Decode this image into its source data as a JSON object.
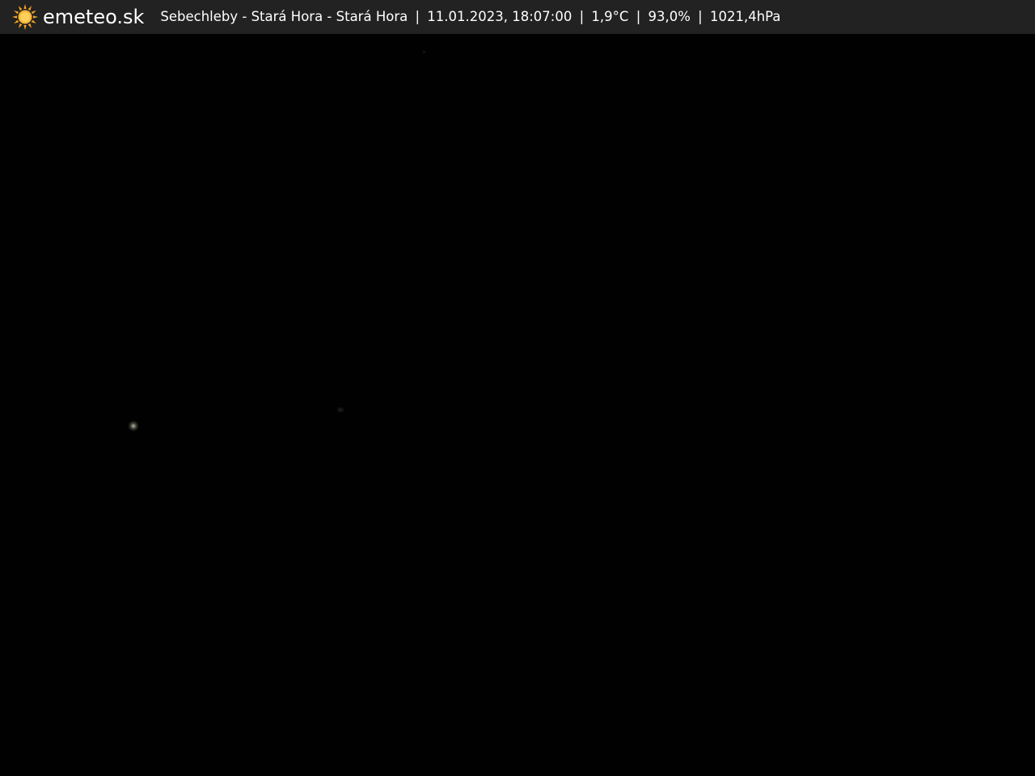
{
  "header": {
    "brand": "emeteo.sk",
    "location": "Sebechleby - Stará Hora - Stará Hora",
    "datetime": "11.01.2023, 18:07:00",
    "temperature": "1,9°C",
    "humidity": "93,0%",
    "pressure": "1021,4hPa",
    "separator": "|"
  },
  "icons": {
    "logo": "sun-icon"
  },
  "colors": {
    "header_bg": "#222222",
    "header_text": "#ffffff",
    "sun": "#f5a623",
    "background": "#000000"
  }
}
